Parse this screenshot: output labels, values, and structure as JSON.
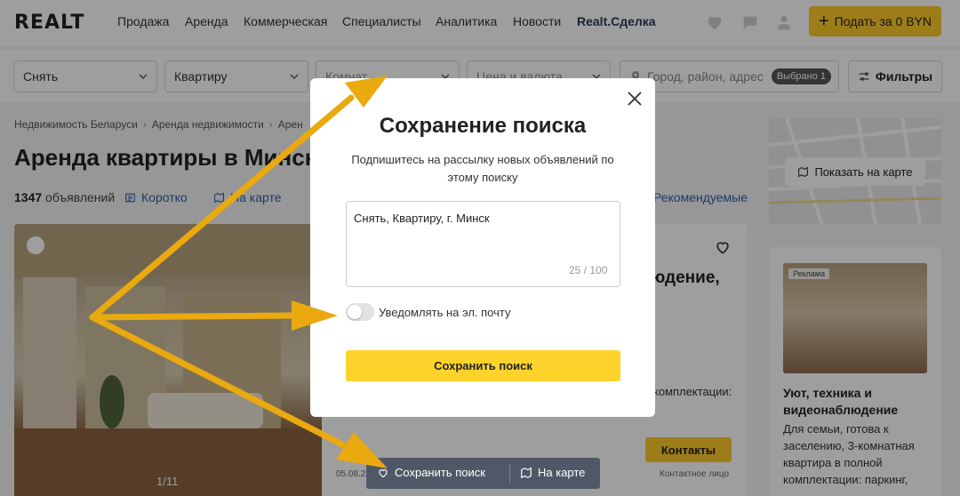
{
  "header": {
    "logo": "REALT",
    "nav": [
      "Продажа",
      "Аренда",
      "Коммерческая",
      "Специалисты",
      "Аналитика",
      "Новости",
      "Realt.Сделка"
    ],
    "post_button": "Подать за 0 BYN"
  },
  "filters": {
    "deal": "Снять",
    "property": "Квартиру",
    "rooms_placeholder": "Комнат",
    "price_placeholder": "Цена и валюта",
    "location_placeholder": "Город, район, адрес",
    "selected_badge": "Выбрано 1",
    "filters_button": "Фильтры"
  },
  "breadcrumbs": [
    "Недвижимость Беларуси",
    "Аренда недвижимости",
    "Арен"
  ],
  "page_title": "Аренда квартиры в Минск",
  "listing_bar": {
    "count": "1347",
    "count_suffix": "объявлений",
    "short_link": "Коротко",
    "map_link": "На карте",
    "sort_link": "Рекомендуемые"
  },
  "card": {
    "photo_counter": "1/11",
    "title_fragment": "людение,",
    "desc_fragment": "комплектации:",
    "contacts_button": "Контакты",
    "contact_person": "Контактное лицо",
    "date_fragment": "05.08.2"
  },
  "sidebar": {
    "show_map": "Показать на карте",
    "ad_badge": "Реклама",
    "ad_title": "Уют, техника и видеонаблюдение",
    "ad_text": "Для семьи, готова к заселению, 3-комнатная квартира в полной комплектации: паркинг,"
  },
  "modal": {
    "title": "Сохранение поиска",
    "subtitle": "Подпишитесь на рассылку новых объявлений по этому поиску",
    "search_value": "Снять, Квартиру, г. Минск",
    "counter": "25 / 100",
    "toggle_label": "Уведомлять на эл. почту",
    "toggle_on": false,
    "save_button": "Сохранить поиск"
  },
  "floatbar": {
    "save_search": "Сохранить поиск",
    "on_map": "На карте"
  },
  "colors": {
    "accent": "#fdc82b",
    "link": "#2f5fa8",
    "arrow": "#e9a90f",
    "floatbar": "#505868"
  }
}
